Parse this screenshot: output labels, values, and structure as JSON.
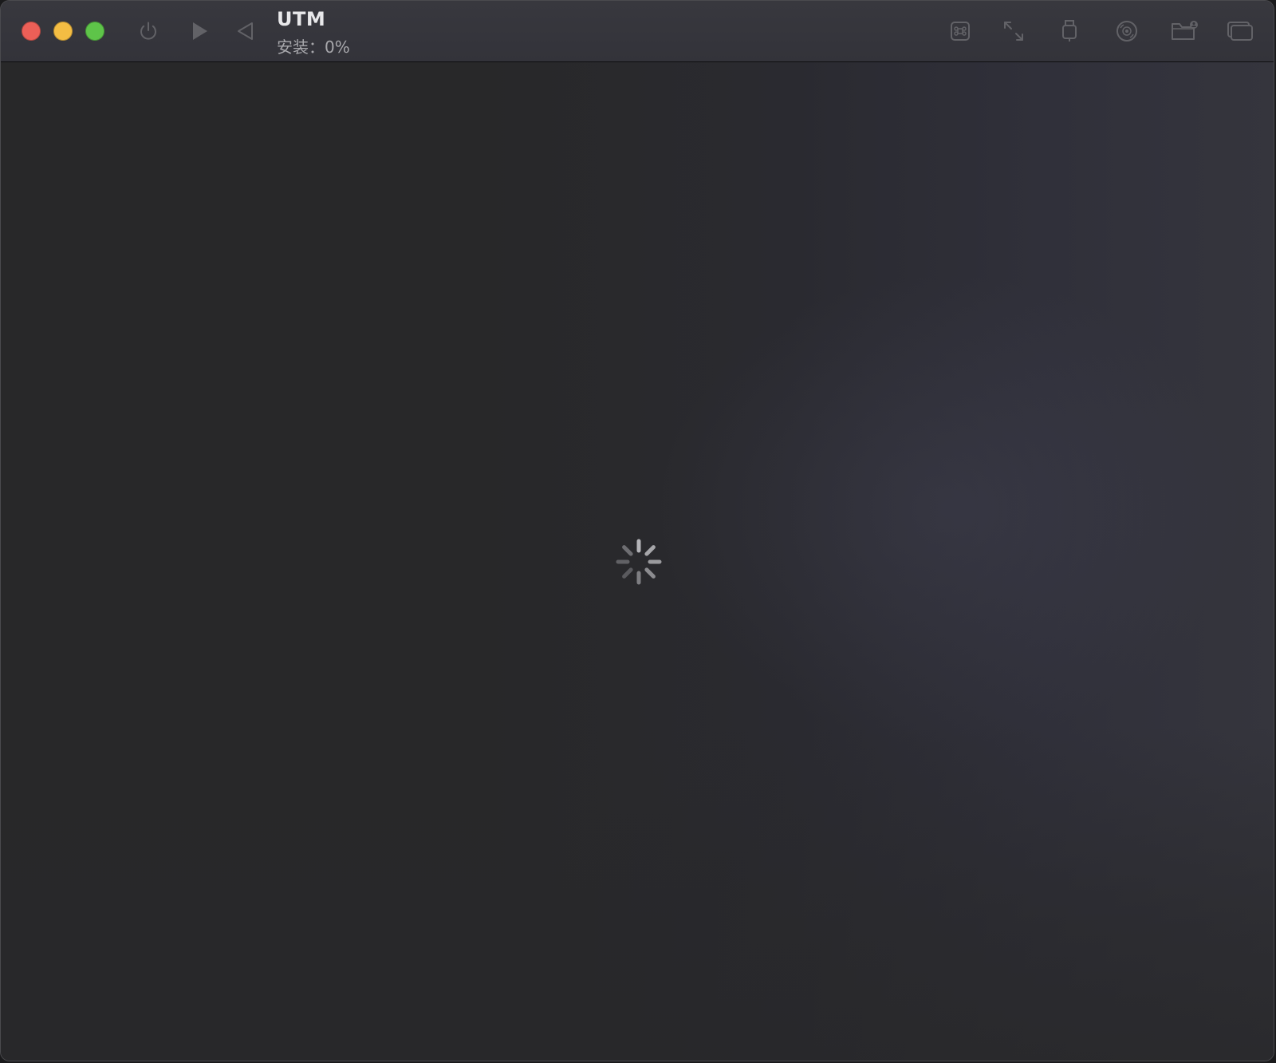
{
  "window": {
    "title": "UTM",
    "subtitle": "安装：0%"
  },
  "traffic_lights": {
    "close_color": "#ec5f57",
    "minimize_color": "#f4bd43",
    "zoom_color": "#5ec449"
  },
  "toolbar": {
    "left_icons": [
      "power-icon",
      "play-icon",
      "back-icon"
    ],
    "right_icons": [
      "command-key-icon",
      "resize-icon",
      "usb-icon",
      "disc-icon",
      "shared-folder-icon",
      "windows-icon"
    ],
    "icon_color": "#6d6d72"
  },
  "content": {
    "state": "loading",
    "spinner_icon": "loading-spinner-icon"
  }
}
